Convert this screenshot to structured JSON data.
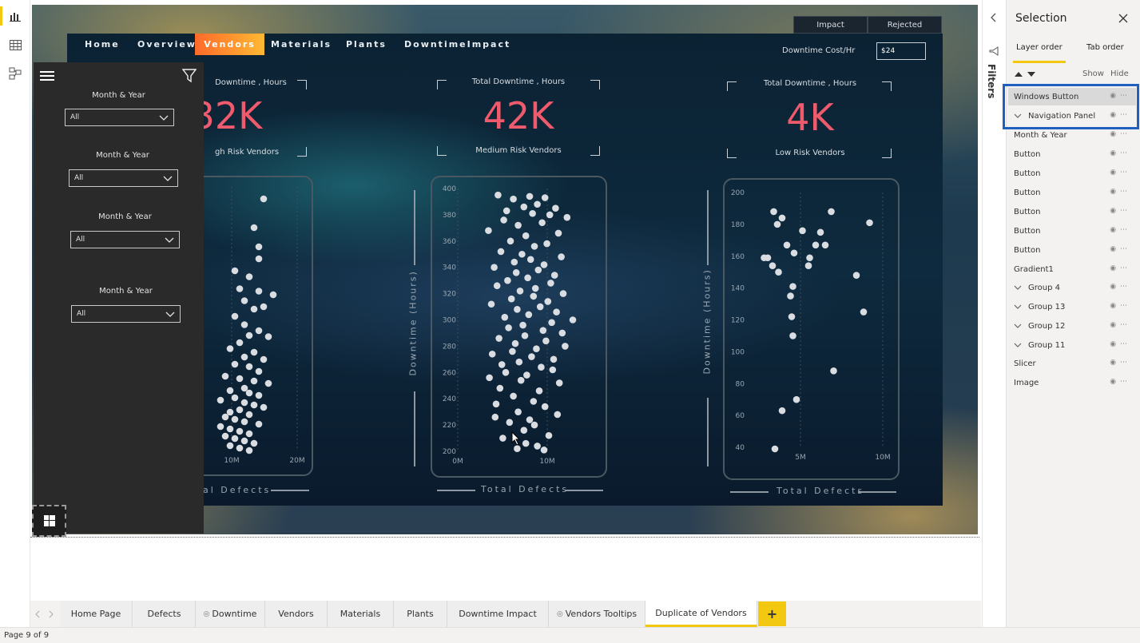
{
  "left_rail": {
    "icons": [
      "report-view-icon",
      "data-view-icon",
      "model-view-icon"
    ]
  },
  "dashboard": {
    "top_tabs": [
      "Impact",
      "Rejected"
    ],
    "nav": [
      "Home",
      "Overview",
      "Vendors",
      "Materials",
      "Plants",
      "DowntimeImpact"
    ],
    "nav_active": "Vendors",
    "downtime_cost_label": "Downtime Cost/Hr",
    "downtime_cost_value": "$24",
    "kpis": [
      {
        "title": "Downtime , Hours",
        "value": "32K",
        "subtitle": "gh Risk Vendors"
      },
      {
        "title": "Total Downtime , Hours",
        "value": "42K",
        "subtitle": "Medium Risk Vendors"
      },
      {
        "title": "Total Downtime , Hours",
        "value": "4K",
        "subtitle": "Low Risk Vendors"
      }
    ],
    "x_axis_title_left": "al Defects",
    "x_axis_title": "Total Defects",
    "y_axis_title": "Downtime (Hours)",
    "cursor": "pointer-cursor"
  },
  "chart_data": [
    {
      "type": "scatter",
      "title": "",
      "xlabel": "al Defects",
      "ylabel": "",
      "x_ticks": [
        "10M",
        "20M"
      ],
      "xlim": [
        0,
        22
      ],
      "ylim": [
        200,
        420
      ],
      "points": [
        [
          13,
          410
        ],
        [
          11,
          386
        ],
        [
          12,
          370
        ],
        [
          12,
          360
        ],
        [
          7,
          350
        ],
        [
          10,
          345
        ],
        [
          8,
          335
        ],
        [
          12,
          333
        ],
        [
          15,
          330
        ],
        [
          9,
          325
        ],
        [
          13,
          320
        ],
        [
          11,
          318
        ],
        [
          7,
          312
        ],
        [
          9,
          305
        ],
        [
          12,
          300
        ],
        [
          10,
          296
        ],
        [
          14,
          295
        ],
        [
          8,
          290
        ],
        [
          6,
          285
        ],
        [
          11,
          282
        ],
        [
          9,
          278
        ],
        [
          13,
          276
        ],
        [
          7,
          272
        ],
        [
          10,
          270
        ],
        [
          12,
          266
        ],
        [
          5,
          262
        ],
        [
          8,
          260
        ],
        [
          11,
          258
        ],
        [
          14,
          256
        ],
        [
          9,
          252
        ],
        [
          6,
          250
        ],
        [
          10,
          248
        ],
        [
          12,
          246
        ],
        [
          7,
          244
        ],
        [
          4,
          242
        ],
        [
          9,
          240
        ],
        [
          11,
          238
        ],
        [
          13,
          236
        ],
        [
          8,
          234
        ],
        [
          6,
          232
        ],
        [
          10,
          230
        ],
        [
          5,
          228
        ],
        [
          7,
          226
        ],
        [
          9,
          224
        ],
        [
          12,
          222
        ],
        [
          4,
          220
        ],
        [
          6,
          218
        ],
        [
          8,
          216
        ],
        [
          10,
          214
        ],
        [
          5,
          212
        ],
        [
          7,
          210
        ],
        [
          9,
          208
        ],
        [
          11,
          206
        ],
        [
          6,
          204
        ],
        [
          8,
          202
        ],
        [
          10,
          200
        ]
      ]
    },
    {
      "type": "scatter",
      "title": "",
      "xlabel": "Total Defects",
      "ylabel": "Downtime (Hours)",
      "x_ticks": [
        "0M",
        "10M"
      ],
      "y_ticks": [
        200,
        220,
        240,
        260,
        280,
        300,
        320,
        340,
        360,
        380,
        400
      ],
      "xlim": [
        0,
        14
      ],
      "ylim": [
        200,
        400
      ],
      "points": [
        [
          4.2,
          395
        ],
        [
          5.8,
          392
        ],
        [
          7.5,
          394
        ],
        [
          9.1,
          393
        ],
        [
          8.3,
          388
        ],
        [
          6.9,
          386
        ],
        [
          10.2,
          385
        ],
        [
          5.1,
          383
        ],
        [
          7.8,
          381
        ],
        [
          9.6,
          380
        ],
        [
          11.4,
          378
        ],
        [
          4.8,
          376
        ],
        [
          8.8,
          374
        ],
        [
          6.3,
          372
        ],
        [
          3.2,
          368
        ],
        [
          10.5,
          366
        ],
        [
          7.1,
          364
        ],
        [
          5.5,
          360
        ],
        [
          9.3,
          358
        ],
        [
          8.0,
          356
        ],
        [
          4.5,
          352
        ],
        [
          6.7,
          350
        ],
        [
          10.8,
          348
        ],
        [
          7.6,
          346
        ],
        [
          5.9,
          344
        ],
        [
          9.0,
          342
        ],
        [
          3.8,
          340
        ],
        [
          8.4,
          338
        ],
        [
          6.1,
          336
        ],
        [
          10.1,
          334
        ],
        [
          7.3,
          332
        ],
        [
          5.2,
          330
        ],
        [
          9.7,
          328
        ],
        [
          4.1,
          326
        ],
        [
          8.1,
          324
        ],
        [
          6.5,
          322
        ],
        [
          11.0,
          320
        ],
        [
          7.9,
          318
        ],
        [
          5.6,
          316
        ],
        [
          9.4,
          314
        ],
        [
          3.5,
          312
        ],
        [
          8.6,
          310
        ],
        [
          6.2,
          308
        ],
        [
          10.3,
          306
        ],
        [
          7.4,
          304
        ],
        [
          4.9,
          302
        ],
        [
          12.0,
          300
        ],
        [
          9.8,
          298
        ],
        [
          6.8,
          296
        ],
        [
          5.3,
          294
        ],
        [
          8.9,
          292
        ],
        [
          10.9,
          290
        ],
        [
          7.0,
          288
        ],
        [
          4.3,
          286
        ],
        [
          9.2,
          284
        ],
        [
          6.0,
          282
        ],
        [
          11.2,
          280
        ],
        [
          8.2,
          278
        ],
        [
          5.7,
          276
        ],
        [
          3.6,
          274
        ],
        [
          7.7,
          272
        ],
        [
          10.0,
          270
        ],
        [
          6.4,
          268
        ],
        [
          4.6,
          266
        ],
        [
          8.7,
          264
        ],
        [
          9.9,
          262
        ],
        [
          5.0,
          260
        ],
        [
          7.2,
          258
        ],
        [
          3.3,
          256
        ],
        [
          6.6,
          254
        ],
        [
          10.6,
          252
        ],
        [
          4.4,
          248
        ],
        [
          8.5,
          246
        ],
        [
          5.8,
          242
        ],
        [
          7.9,
          238
        ],
        [
          4.0,
          236
        ],
        [
          9.1,
          234
        ],
        [
          6.3,
          230
        ],
        [
          10.4,
          228
        ],
        [
          3.9,
          226
        ],
        [
          7.5,
          224
        ],
        [
          5.4,
          222
        ],
        [
          8.0,
          220
        ],
        [
          6.9,
          216
        ],
        [
          9.5,
          212
        ],
        [
          4.7,
          210
        ],
        [
          7.1,
          206
        ],
        [
          8.3,
          204
        ],
        [
          6.2,
          202
        ],
        [
          9.0,
          201
        ]
      ]
    },
    {
      "type": "scatter",
      "title": "",
      "xlabel": "Total Defects",
      "ylabel": "Downtime (Hours)",
      "x_ticks": [
        "5M",
        "10M"
      ],
      "y_ticks": [
        40,
        60,
        80,
        100,
        120,
        140,
        160,
        180,
        200
      ],
      "xlim": [
        0,
        12
      ],
      "ylim": [
        40,
        200
      ],
      "points": [
        [
          2.3,
          188
        ],
        [
          3.0,
          184
        ],
        [
          7.1,
          188
        ],
        [
          10.3,
          181
        ],
        [
          2.6,
          180
        ],
        [
          4.7,
          176
        ],
        [
          6.2,
          175
        ],
        [
          3.4,
          167
        ],
        [
          5.8,
          167
        ],
        [
          6.6,
          167
        ],
        [
          4.0,
          162
        ],
        [
          1.8,
          159
        ],
        [
          1.5,
          159
        ],
        [
          5.3,
          159
        ],
        [
          2.2,
          154
        ],
        [
          5.2,
          154
        ],
        [
          2.7,
          150
        ],
        [
          9.2,
          148
        ],
        [
          3.9,
          141
        ],
        [
          3.7,
          135
        ],
        [
          9.8,
          125
        ],
        [
          3.8,
          122
        ],
        [
          3.9,
          110
        ],
        [
          7.3,
          88
        ],
        [
          4.2,
          70
        ],
        [
          3.0,
          63
        ],
        [
          2.4,
          39
        ]
      ]
    }
  ],
  "nav_panel": {
    "menu_icon": "hamburger-icon",
    "filter_icon": "filter-icon",
    "slicers": [
      {
        "label": "Month & Year",
        "value": "All"
      },
      {
        "label": "Month & Year",
        "value": "All"
      },
      {
        "label": "Month & Year",
        "value": "All"
      },
      {
        "label": "Month & Year",
        "value": "All"
      }
    ],
    "windows_button": "windows-icon"
  },
  "filters_pane": {
    "label": "Filters"
  },
  "selection": {
    "title": "Selection",
    "tabs": [
      "Layer order",
      "Tab order"
    ],
    "show": "Show",
    "hide": "Hide",
    "layers": [
      "Windows Button",
      "Navigation Panel",
      "Month & Year",
      "Button",
      "Button",
      "Button",
      "Button",
      "Button",
      "Button",
      "Gradient1",
      "Group 4",
      "Group 13",
      "Group 12",
      "Group 11",
      "Slicer",
      "Image"
    ]
  },
  "page_tabs": [
    "Home Page",
    "Defects",
    "Downtime",
    "Vendors",
    "Materials",
    "Plants",
    "Downtime Impact",
    "Vendors Tooltips",
    "Duplicate of Vendors"
  ],
  "active_page": "Duplicate of Vendors",
  "add_page": "+",
  "status": "Page 9 of 9",
  "colors": {
    "accent": "#f2c811",
    "kpi": "#ef5b6c",
    "highlight": "#1f5fbf",
    "nav_active": "#ff8a2a"
  }
}
